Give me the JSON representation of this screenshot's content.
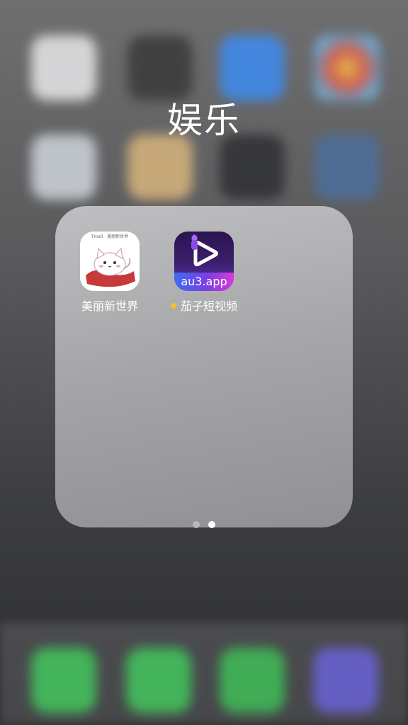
{
  "folder": {
    "title": "娱乐",
    "apps": [
      {
        "label": "美丽新世界",
        "icon": "cat-icon",
        "icon_caption": "Tmall · 美丽新世界",
        "badge": false
      },
      {
        "label": "茄子短视频",
        "icon": "eggplant-play-icon",
        "icon_caption": "au3.app",
        "badge": true
      }
    ],
    "page_count": 2,
    "current_page": 2
  },
  "colors": {
    "badge_dot": "#f5c12a",
    "page_dot_active": "#ffffff",
    "page_dot_inactive": "#b8b8bb"
  }
}
